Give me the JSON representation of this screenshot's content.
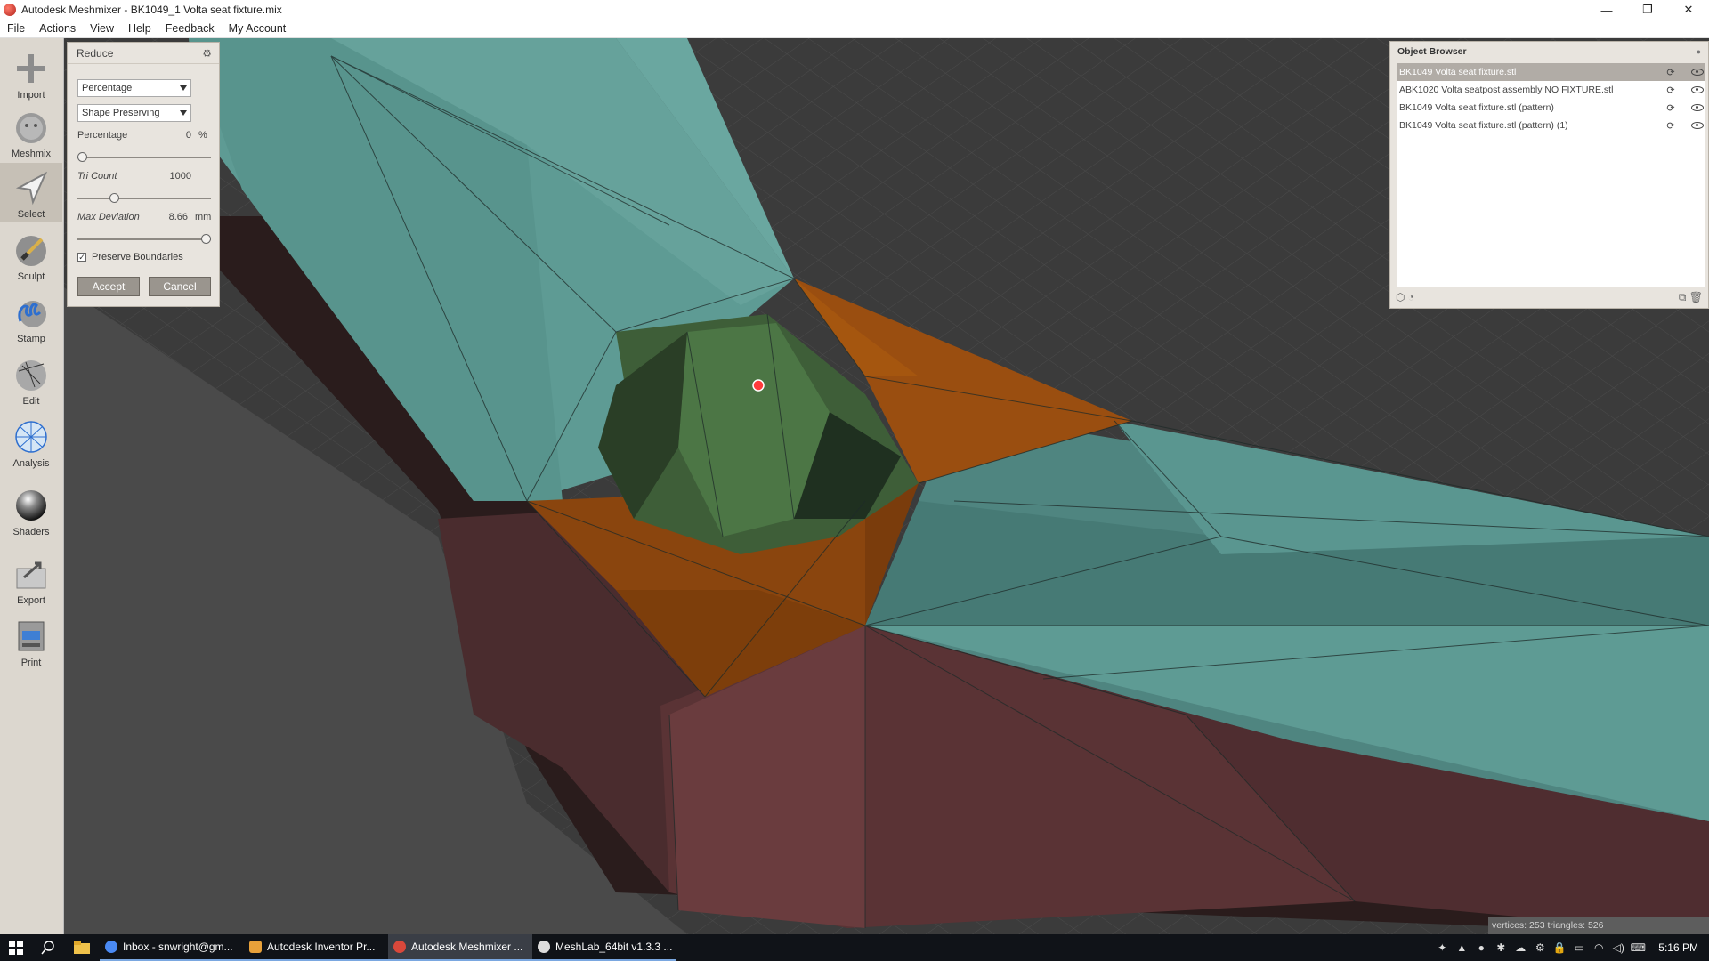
{
  "window": {
    "title": "Autodesk Meshmixer - BK1049_1 Volta seat fixture.mix",
    "minimize": "—",
    "maximize": "❐",
    "close": "✕"
  },
  "menu": [
    "File",
    "Actions",
    "View",
    "Help",
    "Feedback",
    "My Account"
  ],
  "toolbar": {
    "items": [
      {
        "label": "Import",
        "icon": "plus-icon"
      },
      {
        "label": "Meshmix",
        "icon": "bunny-head-icon"
      },
      {
        "label": "Select",
        "icon": "cursor-arrow-icon",
        "active": true
      },
      {
        "label": "Sculpt",
        "icon": "brush-icon"
      },
      {
        "label": "Stamp",
        "icon": "fleur-de-lis-icon"
      },
      {
        "label": "Edit",
        "icon": "sphere-mesh-icon"
      },
      {
        "label": "Analysis",
        "icon": "wire-globe-icon"
      },
      {
        "label": "Shaders",
        "icon": "shiny-sphere-icon"
      },
      {
        "label": "Export",
        "icon": "export-tray-icon"
      },
      {
        "label": "Print",
        "icon": "printer-icon"
      }
    ]
  },
  "reduce": {
    "title": "Reduce",
    "gear": "⚙",
    "mode": "Percentage",
    "type": "Shape Preserving",
    "percentage": {
      "label": "Percentage",
      "value": "0",
      "unit": "%",
      "level": 0
    },
    "tri_count": {
      "label": "Tri Count",
      "value": "1000",
      "level": 0.26
    },
    "max_deviation": {
      "label": "Max Deviation",
      "value": "8.66",
      "unit": "mm",
      "level": 1
    },
    "preserve_boundaries": {
      "label": "Preserve Boundaries",
      "checked": true,
      "mark": "✓"
    },
    "accept": "Accept",
    "cancel": "Cancel"
  },
  "object_browser": {
    "title": "Object Browser",
    "close": "●",
    "items": [
      {
        "name": "BK1049 Volta seat fixture.stl",
        "selected": true
      },
      {
        "name": "ABK1020 Volta seatpost assembly NO FIXTURE.stl",
        "selected": false
      },
      {
        "name": "BK1049 Volta seat fixture.stl (pattern)",
        "selected": false
      },
      {
        "name": "BK1049 Volta seat fixture.stl (pattern) (1)",
        "selected": false
      }
    ],
    "footer_left": "⬡ ◔",
    "footer_right": "⧉ 🗑"
  },
  "status": "vertices: 253 triangles: 526",
  "taskbar": {
    "apps": [
      {
        "label": "Inbox - snwright@gm...",
        "color": "#4a8af4"
      },
      {
        "label": "Autodesk Inventor Pr...",
        "color": "#e8a13a"
      },
      {
        "label": "Autodesk Meshmixer ...",
        "color": "#d9483b",
        "active": true
      },
      {
        "label": "MeshLab_64bit v1.3.3 ...",
        "color": "#dddddd"
      }
    ],
    "clock": "5:16 PM"
  }
}
